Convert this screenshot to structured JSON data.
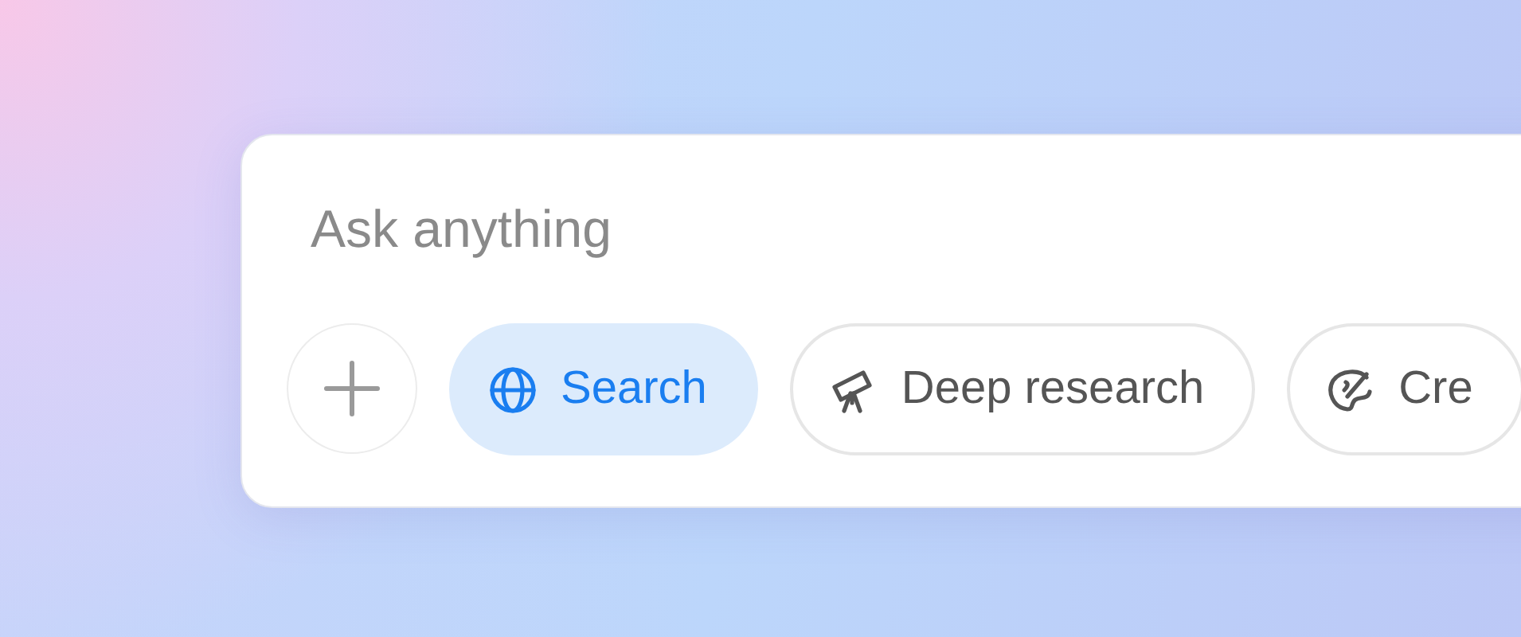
{
  "composer": {
    "placeholder": "Ask anything",
    "tools": [
      {
        "kind": "search",
        "label": "Search",
        "selected": true
      },
      {
        "kind": "research",
        "label": "Deep research",
        "selected": false
      },
      {
        "kind": "create",
        "label": "Cre",
        "selected": false
      }
    ]
  }
}
